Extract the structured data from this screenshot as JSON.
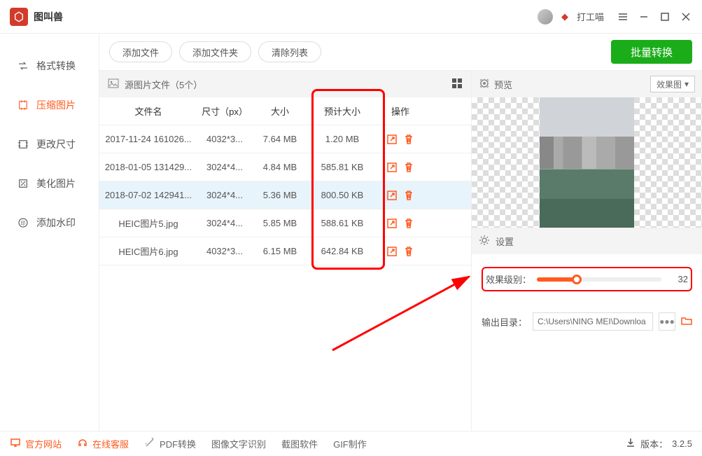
{
  "titlebar": {
    "app_name": "图叫兽",
    "user_name": "打工喵"
  },
  "sidebar": {
    "items": [
      {
        "label": "格式转换"
      },
      {
        "label": "压缩图片"
      },
      {
        "label": "更改尺寸"
      },
      {
        "label": "美化图片"
      },
      {
        "label": "添加水印"
      }
    ]
  },
  "toolbar": {
    "add_file": "添加文件",
    "add_folder": "添加文件夹",
    "clear_list": "清除列表",
    "batch_convert": "批量转换"
  },
  "file_section": {
    "label": "源图片文件（5个）"
  },
  "columns": {
    "name": "文件名",
    "dim": "尺寸（px）",
    "size": "大小",
    "est": "预计大小",
    "op": "操作"
  },
  "files": [
    {
      "name": "2017-11-24 161026...",
      "dim": "4032*3...",
      "size": "7.64 MB",
      "est": "1.20 MB"
    },
    {
      "name": "2018-01-05 131429...",
      "dim": "3024*4...",
      "size": "4.84 MB",
      "est": "585.81 KB"
    },
    {
      "name": "2018-07-02 142941...",
      "dim": "3024*4...",
      "size": "5.36 MB",
      "est": "800.50 KB"
    },
    {
      "name": "HEIC图片5.jpg",
      "dim": "3024*4...",
      "size": "5.85 MB",
      "est": "588.61 KB"
    },
    {
      "name": "HEIC图片6.jpg",
      "dim": "4032*3...",
      "size": "6.15 MB",
      "est": "642.84 KB"
    }
  ],
  "preview": {
    "label": "预览",
    "dropdown": "效果图",
    "settings_label": "设置"
  },
  "settings": {
    "quality_label": "效果级别：",
    "quality_value": "32",
    "output_label": "输出目录：",
    "output_path": "C:\\Users\\NING MEI\\Downloa",
    "more": "●●●"
  },
  "footer": {
    "site": "官方网站",
    "support": "在线客服",
    "pdf": "PDF转换",
    "ocr": "图像文字识别",
    "shot": "截图软件",
    "gif": "GIF制作",
    "version_label": "版本：",
    "version": "3.2.5"
  }
}
